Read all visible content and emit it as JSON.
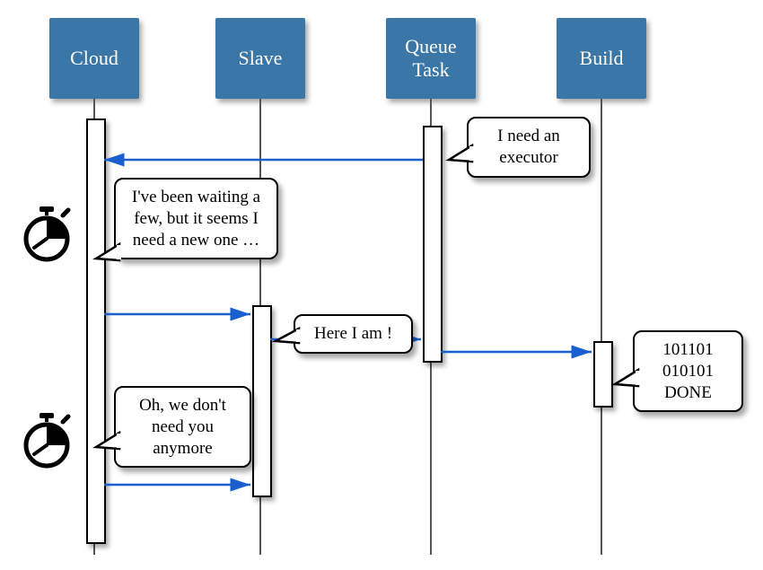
{
  "participants": {
    "cloud": {
      "label": "Cloud"
    },
    "slave": {
      "label": "Slave"
    },
    "queue": {
      "label": "Queue Task"
    },
    "build": {
      "label": "Build"
    }
  },
  "bubbles": {
    "need_executor": "I need an executor",
    "waiting": "I've been waiting a few, but it seems I need a new one …",
    "here_i_am": "Here I am !",
    "dont_need": "Oh, we don't need you anymore",
    "build_done": "101101 010101 DONE"
  },
  "colors": {
    "box": "#3a76a6",
    "arrow": "#1a5fd0"
  }
}
